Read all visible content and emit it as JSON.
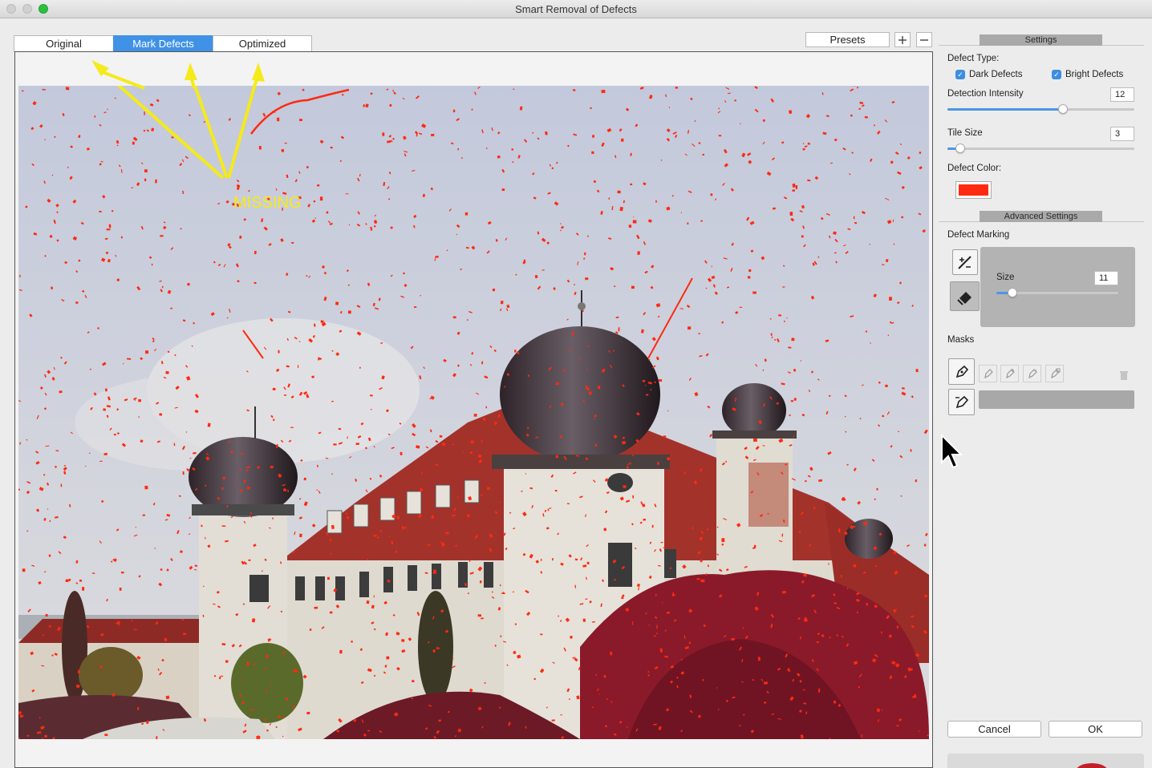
{
  "window": {
    "title": "Smart Removal of Defects"
  },
  "tabs": [
    {
      "label": "Original",
      "active": false
    },
    {
      "label": "Mark Defects",
      "active": true
    },
    {
      "label": "Optimized",
      "active": false
    }
  ],
  "toolbar": {
    "presets_label": "Presets",
    "add_icon": "plus-icon",
    "remove_icon": "minus-icon"
  },
  "annotation": {
    "text": "MISSING",
    "color": "#f5ea1a"
  },
  "settings": {
    "header": "Settings",
    "defect_type_label": "Defect Type:",
    "dark_defects": {
      "label": "Dark Defects",
      "checked": true
    },
    "bright_defects": {
      "label": "Bright Defects",
      "checked": true
    },
    "detection_intensity": {
      "label": "Detection Intensity",
      "value": "12",
      "level": 0.6
    },
    "tile_size": {
      "label": "Tile Size",
      "value": "3",
      "level": 0.06
    },
    "defect_color": {
      "label": "Defect Color:",
      "color": "#ff2a10"
    }
  },
  "advanced": {
    "header": "Advanced Settings",
    "defect_marking_label": "Defect Marking",
    "size": {
      "label": "Size",
      "value": "11",
      "level": 0.14
    },
    "masks_label": "Masks"
  },
  "buttons": {
    "cancel": "Cancel",
    "ok": "OK"
  },
  "colors": {
    "accent": "#3f92e6",
    "defect_marks": "#ff2a10"
  }
}
